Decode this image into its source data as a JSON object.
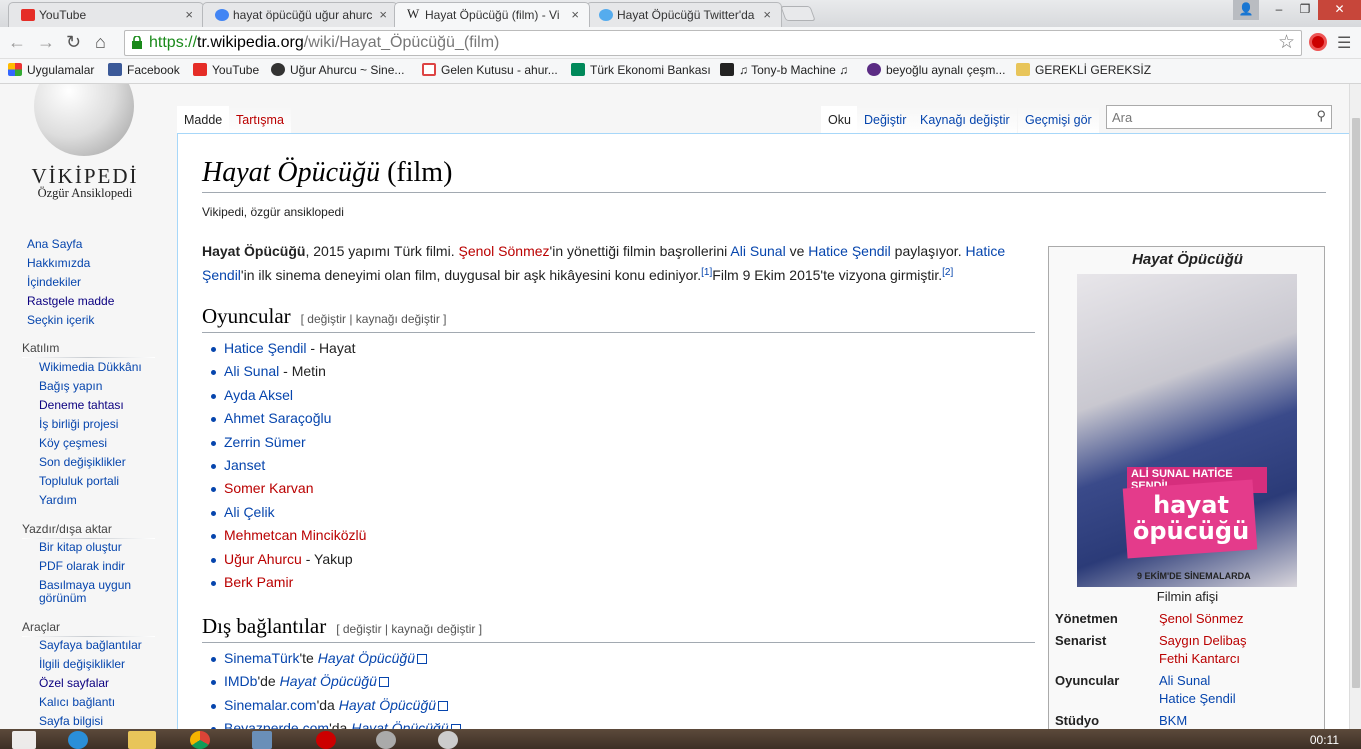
{
  "browser": {
    "tabs": [
      {
        "title": "YouTube",
        "favicon": "youtube-icon"
      },
      {
        "title": "hayat öpücüğü uğur ahurc",
        "favicon": "google-icon"
      },
      {
        "title": "Hayat Öpücüğü (film) - Vi",
        "favicon": "wikipedia-icon"
      },
      {
        "title": "Hayat Öpücüğü Twitter'da",
        "favicon": "twitter-icon"
      }
    ],
    "url_scheme": "https://",
    "url_host": "tr.wikipedia.org",
    "url_path": "/wiki/Hayat_Öpücüğü_(film)",
    "bookmarks": [
      "Uygulamalar",
      "Facebook",
      "YouTube",
      "Uğur Ahurcu ~ Sine...",
      "Gelen Kutusu - ahur...",
      "Türk Ekonomi Bankası",
      "♫ Tony-b Machine ♫",
      "beyoğlu aynalı çeşm...",
      "GEREKLİ GEREKSİZ"
    ]
  },
  "wiki": {
    "logo_name": "VİKİPEDİ",
    "logo_sub": "Özgür Ansiklopedi",
    "nav": [
      "Ana Sayfa",
      "Hakkımızda",
      "İçindekiler",
      "Rastgele madde",
      "Seçkin içerik"
    ],
    "participation": {
      "title": "Katılım",
      "items": [
        "Wikimedia Dükkânı",
        "Bağış yapın",
        "Deneme tahtası",
        "İş birliği projesi",
        "Köy çeşmesi",
        "Son değişiklikler",
        "Topluluk portali",
        "Yardım"
      ]
    },
    "print": {
      "title": "Yazdır/dışa aktar",
      "items": [
        "Bir kitap oluştur",
        "PDF olarak indir",
        "Basılmaya uygun görünüm"
      ]
    },
    "tools": {
      "title": "Araçlar",
      "items": [
        "Sayfaya bağlantılar",
        "İlgili değişiklikler",
        "Özel sayfalar",
        "Kalıcı bağlantı",
        "Sayfa bilgisi"
      ]
    },
    "tabs": {
      "article": "Madde",
      "talk": "Tartışma",
      "read": "Oku",
      "edit": "Değiştir",
      "edit_source": "Kaynağı değiştir",
      "history": "Geçmişi gör"
    },
    "search_placeholder": "Ara"
  },
  "article": {
    "title_italic": "Hayat Öpücüğü",
    "title_rest": " (film)",
    "tagline": "Vikipedi, özgür ansiklopedi",
    "intro": {
      "bold": "Hayat Öpücüğü",
      "t1": ", 2015 yapımı Türk filmi. ",
      "director": "Şenol Sönmez",
      "t2": "'in yönettiği filmin başrollerini ",
      "actor1": "Ali Sunal",
      "t3": " ve ",
      "actor2": "Hatice Şendil",
      "t4": " paylaşıyor. ",
      "actor2b": "Hatice Şendil",
      "t5": "'in ilk sinema deneyimi olan film, duygusal bir aşk hikâyesini konu ediniyor.",
      "ref1": "[1]",
      "t6": "Film 9 Ekim 2015'te vizyona girmiştir.",
      "ref2": "[2]"
    },
    "cast_heading": "Oyuncular",
    "edit_links": "[ değiştir | kaynağı değiştir ]",
    "cast": [
      {
        "name": "Hatice Şendil",
        "role": " - Hayat",
        "exists": true
      },
      {
        "name": "Ali Sunal",
        "role": " - Metin",
        "exists": true
      },
      {
        "name": "Ayda Aksel",
        "role": "",
        "exists": true
      },
      {
        "name": "Ahmet Saraçoğlu",
        "role": "",
        "exists": true
      },
      {
        "name": "Zerrin Sümer",
        "role": "",
        "exists": true
      },
      {
        "name": "Janset",
        "role": "",
        "exists": true
      },
      {
        "name": "Somer Karvan",
        "role": "",
        "exists": false
      },
      {
        "name": "Ali Çelik",
        "role": "",
        "exists": true
      },
      {
        "name": "Mehmetcan Minciközlü",
        "role": "",
        "exists": false
      },
      {
        "name": "Uğur Ahurcu",
        "role": " - Yakup",
        "exists": false
      },
      {
        "name": "Berk Pamir",
        "role": "",
        "exists": false
      }
    ],
    "links_heading": "Dış bağlantılar",
    "external": [
      {
        "site": "SinemaTürk",
        "suffix": "'te ",
        "title": "Hayat Öpücüğü"
      },
      {
        "site": "IMDb",
        "suffix": "'de ",
        "title": "Hayat Öpücüğü"
      },
      {
        "site": "Sinemalar.com",
        "suffix": "'da ",
        "title": "Hayat Öpücüğü"
      },
      {
        "site": "Beyazperde.com",
        "suffix": "'da ",
        "title": "Hayat Öpücüğü"
      }
    ]
  },
  "infobox": {
    "title": "Hayat Öpücüğü",
    "poster_names": "ALİ SUNAL   HATİCE ŞENDİL",
    "poster_title": "hayat öpücüğü",
    "poster_date": "9 EKİM'DE SİNEMALARDA",
    "caption": "Filmin afişi",
    "director_label": "Yönetmen",
    "director": "Şenol Sönmez",
    "writer_label": "Senarist",
    "writer1": "Saygın Delibaş",
    "writer2": "Fethi Kantarcı",
    "cast_label": "Oyuncular",
    "cast1": "Ali Sunal",
    "cast2": "Hatice Şendil",
    "studio_label": "Stüdyo",
    "studio": "BKM"
  },
  "taskbar": {
    "time": "00:11"
  }
}
